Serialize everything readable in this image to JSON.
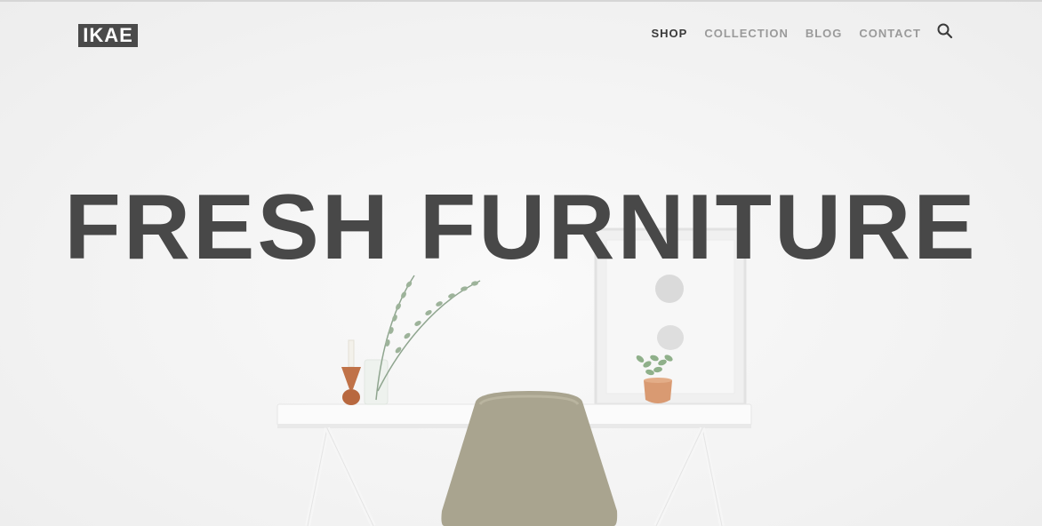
{
  "header": {
    "logo_text": "IKAE",
    "nav": [
      {
        "label": "SHOP",
        "active": true
      },
      {
        "label": "COLLECTION",
        "active": false
      },
      {
        "label": "BLOG",
        "active": false
      },
      {
        "label": "CONTACT",
        "active": false
      }
    ],
    "search_icon": "search-icon"
  },
  "hero": {
    "title": "FRESH FURNITURE"
  },
  "colors": {
    "background": "#f4f4f4",
    "text_dark": "#484848",
    "nav_inactive": "#9a9a9a",
    "nav_active": "#3a3a3a",
    "logo_bg": "#4a4a4a",
    "chair": "#a9a48f",
    "copper": "#d99a72"
  }
}
